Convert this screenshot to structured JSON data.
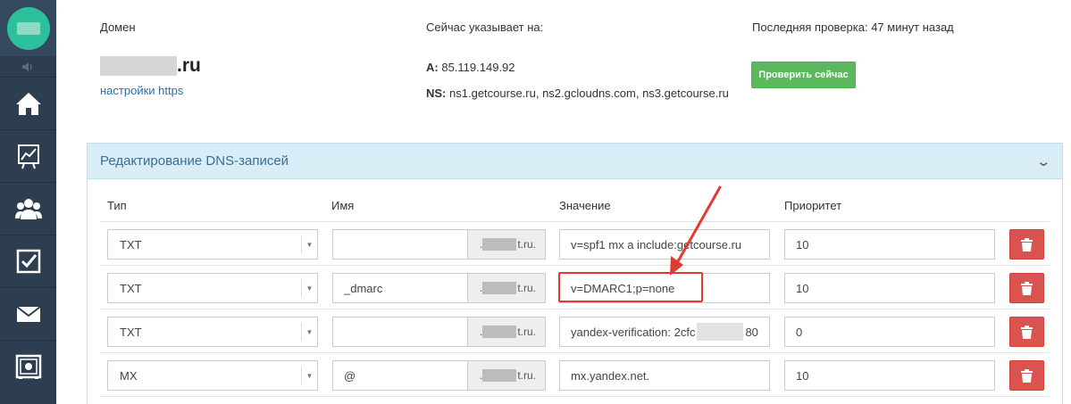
{
  "sidebar": {
    "icons": [
      "home-icon",
      "chart-icon",
      "users-icon",
      "checkbox-icon",
      "mail-icon",
      "safe-icon"
    ]
  },
  "domain": {
    "label": "Домен",
    "name_suffix": ".ru",
    "https_link": "настройки https"
  },
  "points_to": {
    "label": "Сейчас указывает на:",
    "a_label": "A:",
    "a_value": "85.119.149.92",
    "ns_label": "NS:",
    "ns_value": "ns1.getcourse.ru, ns2.gcloudns.com, ns3.getcourse.ru"
  },
  "last_check": {
    "label": "Последняя проверка: 47 минут назад",
    "button": "Проверить сейчас"
  },
  "panel": {
    "title": "Редактирование DNS-записей"
  },
  "columns": {
    "type": "Тип",
    "name": "Имя",
    "value": "Значение",
    "priority": "Приоритет"
  },
  "records": [
    {
      "type": "TXT",
      "name": "",
      "suffix_pre": ".",
      "suffix_post": "t.ru.",
      "value": "v=spf1 mx a include:getcourse.ru",
      "value_tail": "",
      "priority": "10"
    },
    {
      "type": "TXT",
      "name": "_dmarc",
      "suffix_pre": ".",
      "suffix_post": "t.ru.",
      "value": "v=DMARC1;p=none",
      "value_tail": "",
      "priority": "10"
    },
    {
      "type": "TXT",
      "name": "",
      "suffix_pre": ".",
      "suffix_post": "t.ru.",
      "value": "yandex-verification: 2cfc",
      "value_tail": "80",
      "priority": "0"
    },
    {
      "type": "MX",
      "name": "@",
      "suffix_pre": ".",
      "suffix_post": "t.ru.",
      "value": "mx.yandex.net.",
      "value_tail": "",
      "priority": "10"
    }
  ],
  "colors": {
    "sidebar": "#2d3e50",
    "success": "#5cb85c",
    "danger": "#d9534f",
    "panel_head": "#d9edf7",
    "annotation": "#e03b2e"
  }
}
